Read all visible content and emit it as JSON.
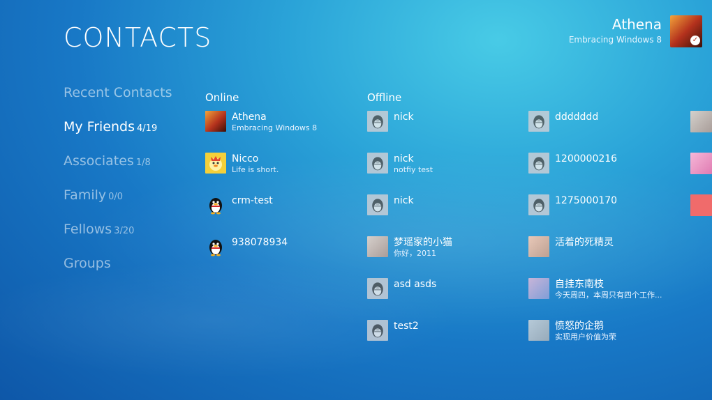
{
  "header": {
    "title": "CONTACTS"
  },
  "user": {
    "name": "Athena",
    "status": "Embracing Windows 8",
    "badge_icon": "check-icon"
  },
  "nav": [
    {
      "label": "Recent Contacts",
      "count": ""
    },
    {
      "label": "My Friends",
      "count": "4/19",
      "active": true
    },
    {
      "label": "Associates",
      "count": "1/8"
    },
    {
      "label": "Family",
      "count": "0/0"
    },
    {
      "label": "Fellows",
      "count": "3/20"
    },
    {
      "label": "Groups",
      "count": ""
    }
  ],
  "online": {
    "heading": "Online",
    "contacts": [
      {
        "name": "Athena",
        "status": "Embracing Windows 8",
        "avatar": "sunset-photo"
      },
      {
        "name": "Nicco",
        "status": "Life is short.",
        "avatar": "duck-icon"
      },
      {
        "name": "crm-test",
        "status": "",
        "avatar": "penguin-icon"
      },
      {
        "name": "938078934",
        "status": "",
        "avatar": "penguin-icon"
      }
    ]
  },
  "offline": {
    "heading": "Offline",
    "col1": [
      {
        "name": "nick",
        "status": "",
        "avatar": "penguin-icon"
      },
      {
        "name": "nick",
        "status": "notfiy test",
        "avatar": "penguin-icon"
      },
      {
        "name": "nick",
        "status": "",
        "avatar": "penguin-icon"
      },
      {
        "name": "梦瑶家的小猫",
        "status": "你好，2011",
        "avatar": "photo"
      },
      {
        "name": "asd asds",
        "status": "",
        "avatar": "penguin-icon"
      },
      {
        "name": "test2",
        "status": "",
        "avatar": "penguin-icon"
      }
    ],
    "col2": [
      {
        "name": "ddddddd",
        "status": "",
        "avatar": "penguin-icon"
      },
      {
        "name": "1200000216",
        "status": "",
        "avatar": "penguin-icon"
      },
      {
        "name": "1275000170",
        "status": "",
        "avatar": "penguin-icon"
      },
      {
        "name": "活着的死精灵",
        "status": "",
        "avatar": "photo"
      },
      {
        "name": "自挂东南枝",
        "status": "今天周四，本周只有四个工作...",
        "avatar": "photo"
      },
      {
        "name": "愤怒的企鹅",
        "status": "实现用户价值为荣",
        "avatar": "photo"
      }
    ]
  }
}
